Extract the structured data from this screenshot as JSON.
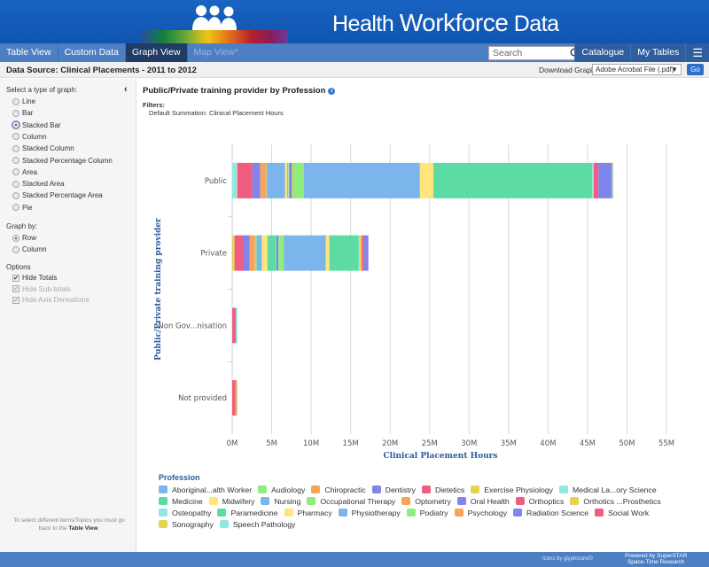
{
  "header": {
    "title_a": "Health ",
    "title_b": "Workforce",
    "title_c": " Data"
  },
  "nav": {
    "items": [
      "Table View",
      "Custom Data",
      "Graph View",
      "Map View*"
    ],
    "active": "Graph View",
    "search_placeholder": "Search",
    "right": [
      "Catalogue",
      "My Tables"
    ]
  },
  "subbar": {
    "data_source": "Data Source: Clinical Placements - 2011 to 2012",
    "download_label": "Download Graph:",
    "download_value": "Adobe Acrobat File (.pdf)",
    "go": "Go"
  },
  "sidebar": {
    "graph_type_label": "Select a type of graph:",
    "graph_types": [
      "Line",
      "Bar",
      "Stacked Bar",
      "Column",
      "Stacked Column",
      "Stacked Percentage Column",
      "Area",
      "Stacked Area",
      "Stacked Percentage Area",
      "Pie"
    ],
    "selected_type": "Stacked Bar",
    "graph_by_label": "Graph by:",
    "graph_by": [
      "Row",
      "Column"
    ],
    "selected_by": "Row",
    "options_label": "Options",
    "options": [
      {
        "label": "Hide Totals",
        "checked": true,
        "enabled": true
      },
      {
        "label": "Hide Sub-totals",
        "checked": true,
        "enabled": false
      },
      {
        "label": "Hide Axis Derivations",
        "checked": true,
        "enabled": false
      }
    ],
    "note_a": "To select different items/Topics you must go back to the ",
    "note_b": "Table View",
    "note_c": "."
  },
  "chart_header": {
    "title": "Public/Private training provider by Profession",
    "filters_label": "Filters:",
    "filters_value": "Default Summation: Clinical Placement Hours"
  },
  "chart_data": {
    "type": "bar",
    "stacked": true,
    "orientation": "horizontal",
    "ylabel": "Public/Private training provider",
    "xlabel": "Clinical Placement Hours",
    "categories": [
      "Public",
      "Private",
      "Non Gov...nisation",
      "Not provided"
    ],
    "xlim": [
      0,
      55000000
    ],
    "ticks": [
      "0M",
      "5M",
      "10M",
      "15M",
      "20M",
      "25M",
      "30M",
      "35M",
      "40M",
      "45M",
      "50M",
      "55M"
    ],
    "grid": true,
    "legend_title": "Profession",
    "legend_position": "bottom",
    "colors": [
      "#7cb5ec",
      "#90ed7d",
      "#f7a35c",
      "#8085e9",
      "#f15c80",
      "#e4d354",
      "#91e8e1",
      "#5cdca4",
      "#ffe57a"
    ],
    "series": [
      {
        "name": "Aboriginal...alth Worker",
        "values": [
          50000,
          0,
          0,
          0
        ]
      },
      {
        "name": "Audiology",
        "values": [
          50000,
          0,
          0,
          0
        ]
      },
      {
        "name": "Chiropractic",
        "values": [
          50000,
          0,
          0,
          0
        ]
      },
      {
        "name": "Dentistry",
        "values": [
          1700000,
          550000,
          0,
          0
        ]
      },
      {
        "name": "Dietetics",
        "values": [
          600000,
          300000,
          0,
          0
        ]
      },
      {
        "name": "Exercise Physiology",
        "values": [
          100000,
          300000,
          0,
          0
        ]
      },
      {
        "name": "Medical La...ory Science",
        "values": [
          100000,
          100000,
          200000,
          50000
        ]
      },
      {
        "name": "Medicine",
        "values": [
          20100000,
          3700000,
          0,
          0
        ]
      },
      {
        "name": "Midwifery",
        "values": [
          1700000,
          450000,
          0,
          0
        ]
      },
      {
        "name": "Nursing",
        "values": [
          14700000,
          5300000,
          0,
          0
        ]
      },
      {
        "name": "Occupational Therapy",
        "values": [
          1450000,
          700000,
          0,
          0
        ]
      },
      {
        "name": "Optometry",
        "values": [
          100000,
          0,
          0,
          200000
        ]
      },
      {
        "name": "Oral Health",
        "values": [
          280000,
          250000,
          0,
          0
        ]
      },
      {
        "name": "Orthoptics",
        "values": [
          50000,
          0,
          0,
          0
        ]
      },
      {
        "name": "Orthotics ...Prosthetics",
        "values": [
          50000,
          0,
          0,
          0
        ]
      },
      {
        "name": "Osteopathy",
        "values": [
          50000,
          50000,
          0,
          0
        ]
      },
      {
        "name": "Paramedicine",
        "values": [
          150000,
          1100000,
          0,
          0
        ]
      },
      {
        "name": "Pharmacy",
        "values": [
          250000,
          700000,
          0,
          0
        ]
      },
      {
        "name": "Physiotherapy",
        "values": [
          2300000,
          650000,
          0,
          0
        ]
      },
      {
        "name": "Podiatry",
        "values": [
          50000,
          200000,
          0,
          0
        ]
      },
      {
        "name": "Psychology",
        "values": [
          800000,
          700000,
          0,
          0
        ]
      },
      {
        "name": "Radiation Science",
        "values": [
          1000000,
          800000,
          0,
          0
        ]
      },
      {
        "name": "Social Work",
        "values": [
          1900000,
          1100000,
          450000,
          400000
        ]
      },
      {
        "name": "Sonography",
        "values": [
          50000,
          300000,
          0,
          0
        ]
      },
      {
        "name": "Speech Pathology",
        "values": [
          600000,
          0,
          0,
          0
        ]
      }
    ]
  },
  "footer": {
    "icons": "Icons by glyphicons©",
    "powered_a": "Powered by SuperSTAR",
    "powered_b": "Space-Time Research"
  }
}
